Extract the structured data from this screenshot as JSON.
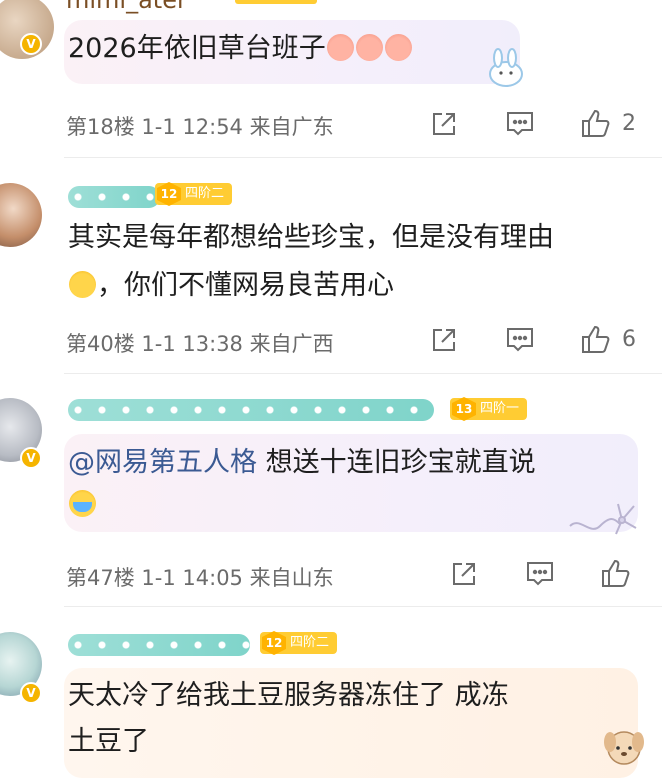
{
  "comments": [
    {
      "name_partial": "mimi_ater",
      "text": "2026年依旧草台班子",
      "floor": "第18楼",
      "date": "1-1 12:54",
      "location": "来自广东",
      "likes": "2"
    },
    {
      "level_num": "12",
      "level_label": "四阶二",
      "text_line1": "其实是每年都想给些珍宝，但是没有理由",
      "text_line2": "，你们不懂网易良苦用心",
      "floor": "第40楼",
      "date": "1-1 13:38",
      "location": "来自广西",
      "likes": "6"
    },
    {
      "level_num": "13",
      "level_label": "四阶一",
      "mention": "@网易第五人格",
      "text": " 想送十连旧珍宝就直说",
      "floor": "第47楼",
      "date": "1-1 14:05",
      "location": "来自山东",
      "likes": ""
    },
    {
      "level_num": "12",
      "level_label": "四阶二",
      "text_line1": "天太冷了给我土豆服务器冻住了  成冻",
      "text_line2": "土豆了"
    }
  ],
  "badge_v": "V",
  "icons": [
    "share-icon",
    "comment-icon",
    "like-icon",
    "verified-badge-icon",
    "level-badge-icon",
    "emoji-icon"
  ],
  "colors": {
    "level_badge": "#ffcc33",
    "verified": "#f5b400",
    "meta_text": "#6b6b6b",
    "mention": "#3b5a93"
  }
}
